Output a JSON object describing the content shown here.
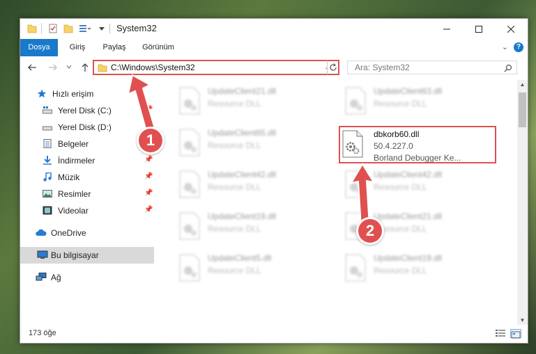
{
  "window": {
    "title": "System32"
  },
  "ribbon": {
    "tabs": [
      "Dosya",
      "Giriş",
      "Paylaş",
      "Görünüm"
    ]
  },
  "address": {
    "path": "C:\\Windows\\System32"
  },
  "search": {
    "placeholder": "Ara: System32"
  },
  "sidebar": {
    "items": [
      {
        "label": "Hızlı erişim",
        "icon": "star-icon"
      },
      {
        "label": "Yerel Disk (C:)",
        "icon": "drive-icon"
      },
      {
        "label": "Yerel Disk (D:)",
        "icon": "drive-icon"
      },
      {
        "label": "Belgeler",
        "icon": "document-icon"
      },
      {
        "label": "İndirmeler",
        "icon": "download-icon"
      },
      {
        "label": "Müzik",
        "icon": "music-icon"
      },
      {
        "label": "Resimler",
        "icon": "picture-icon"
      },
      {
        "label": "Videolar",
        "icon": "video-icon"
      },
      {
        "label": "OneDrive",
        "icon": "cloud-icon"
      },
      {
        "label": "Bu bilgisayar",
        "icon": "computer-icon"
      },
      {
        "label": "Ağ",
        "icon": "network-icon"
      }
    ]
  },
  "files_left": [
    {
      "name": "UpdateClient21.dll",
      "type": "Resource DLL"
    },
    {
      "name": "UpdateClient65.dll",
      "type": "Resource DLL"
    },
    {
      "name": "UpdateClient42.dll",
      "type": "Resource DLL"
    },
    {
      "name": "UpdateClient19.dll",
      "type": "Resource DLL"
    },
    {
      "name": "UpdateClient5.dll",
      "type": "Resource DLL"
    }
  ],
  "files_right": [
    {
      "name": "UpdateClient63.dll",
      "type": "Resource DLL"
    },
    {
      "name": "UpdateClient42.dll",
      "type": "Resource DLL"
    },
    {
      "name": "UpdateClient21.dll",
      "type": "Resource DLL"
    },
    {
      "name": "UpdateClient19.dll",
      "type": "Resource DLL"
    }
  ],
  "highlighted_file": {
    "name": "dbkorb60.dll",
    "version": "50.4.227.0",
    "description": "Borland Debugger Ke..."
  },
  "status": {
    "count": "173 öğe"
  },
  "annotations": {
    "step1": "1",
    "step2": "2"
  },
  "colors": {
    "accent": "#1979ca",
    "highlight": "#e05050"
  }
}
